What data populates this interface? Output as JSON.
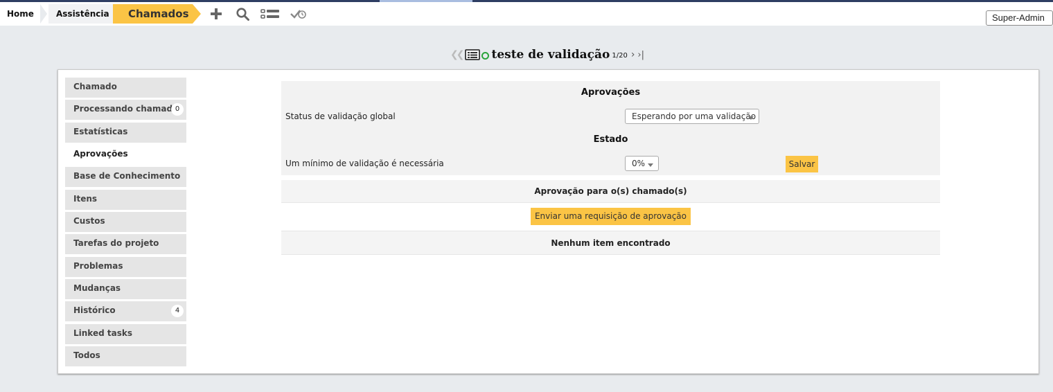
{
  "breadcrumb": {
    "home": "Home",
    "assistance": "Assistência",
    "current": "Chamados"
  },
  "toolbar": {
    "icons": [
      "plus-icon",
      "search-icon",
      "list-icon",
      "validation-icon"
    ]
  },
  "profile": {
    "label": "Super-Admin"
  },
  "item_header": {
    "title": "teste de validação",
    "counter": "1/20",
    "status_color": "#2aa33b"
  },
  "tabs": [
    {
      "label": "Chamado",
      "badge": null
    },
    {
      "label": "Processando chamado",
      "badge": "0"
    },
    {
      "label": "Estatísticas",
      "badge": null
    },
    {
      "label": "Aprovações",
      "badge": null,
      "active": true
    },
    {
      "label": "Base de Conhecimento",
      "badge": null
    },
    {
      "label": "Itens",
      "badge": null
    },
    {
      "label": "Custos",
      "badge": null
    },
    {
      "label": "Tarefas do projeto",
      "badge": null
    },
    {
      "label": "Problemas",
      "badge": null
    },
    {
      "label": "Mudanças",
      "badge": null
    },
    {
      "label": "Histórico",
      "badge": "4"
    },
    {
      "label": "Linked tasks",
      "badge": null
    },
    {
      "label": "Todos",
      "badge": null
    }
  ],
  "approvals": {
    "heading": "Aprovações",
    "global_status_label": "Status de validação global",
    "global_status_value": "Esperando por uma validação",
    "state_heading": "Estado",
    "min_validation_label": "Um mínimo de validação é necessária",
    "min_validation_value": "0%",
    "save_label": "Salvar",
    "list_heading": "Aprovação para o(s) chamado(s)",
    "request_label": "Enviar uma requisição de aprovação",
    "empty_label": "Nenhum item encontrado"
  },
  "colors": {
    "accent": "#fbc445",
    "header_dark": "#2e3e63",
    "background": "#e8ebee"
  }
}
